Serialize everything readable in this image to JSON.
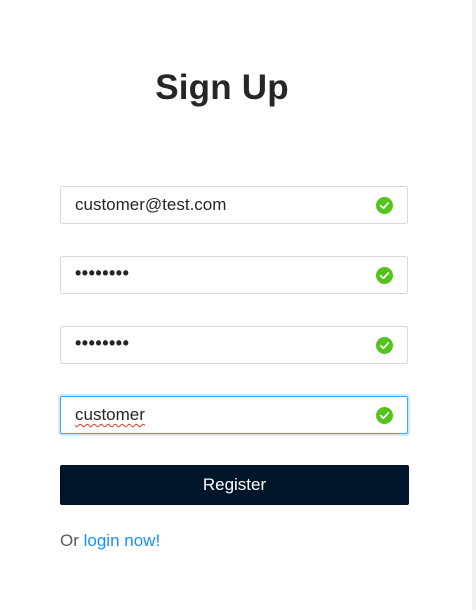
{
  "signup": {
    "title": "Sign Up",
    "fields": [
      {
        "name": "email",
        "value": "customer@test.com",
        "status": "valid"
      },
      {
        "name": "password",
        "value": "••••••••",
        "status": "valid"
      },
      {
        "name": "confirm_password",
        "value": "••••••••",
        "status": "valid"
      },
      {
        "name": "username",
        "value": "customer",
        "status": "valid"
      }
    ],
    "register_label": "Register",
    "login_prefix": "Or",
    "login_link": "login now!"
  },
  "icons": {
    "field_status": "check-circle-icon"
  },
  "colors": {
    "primary_button": "#001529",
    "link": "#1890ff",
    "success": "#52c41a",
    "focus_border": "#40a9ff",
    "spellcheck": "#e0362e"
  }
}
